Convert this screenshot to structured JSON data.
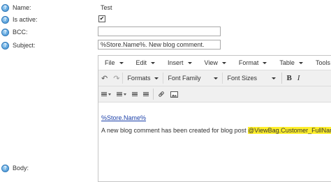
{
  "form": {
    "name_label": "Name:",
    "name_value": "Test",
    "active_label": "Is active:",
    "active_checked": true,
    "active_mark": "✔",
    "bcc_label": "BCC:",
    "bcc_value": "",
    "subject_label": "Subject:",
    "subject_value": "%Store.Name%. New blog comment.",
    "body_label": "Body:"
  },
  "editor": {
    "menus": [
      "File",
      "Edit",
      "Insert",
      "View",
      "Format",
      "Table",
      "Tools"
    ],
    "formats_label": "Formats",
    "font_family_label": "Font Family",
    "font_sizes_label": "Font Sizes",
    "bold_label": "B",
    "italic_label": "I",
    "content_link": "%Store.Name%",
    "content_text": "A new blog comment has been created for blog post ",
    "content_token": "@ViewBag.Customer_FullName",
    "highlight_color": "#ffef2b"
  }
}
